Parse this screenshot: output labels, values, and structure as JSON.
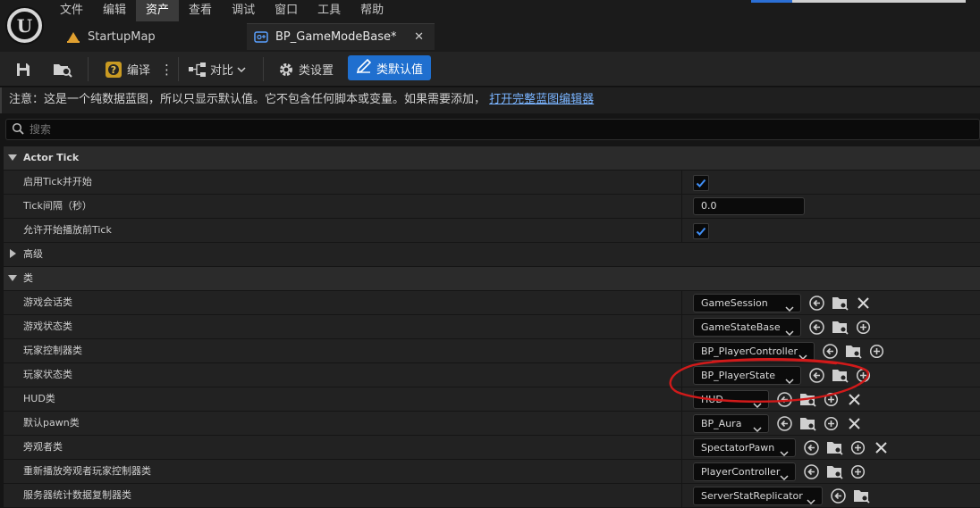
{
  "menu": [
    "文件",
    "编辑",
    "资产",
    "查看",
    "调试",
    "窗口",
    "工具",
    "帮助"
  ],
  "menu_active": "资产",
  "logo_text": "U",
  "tabs": {
    "map": "StartupMap",
    "blueprint": "BP_GameModeBase*",
    "close_glyph": "✕"
  },
  "toolbar": {
    "compile": "编译",
    "more": "⋮",
    "diff": "对比",
    "class_settings": "类设置",
    "class_defaults": "类默认值"
  },
  "note": {
    "text": "注意：这是一个纯数据蓝图，所以只显示默认值。它不包含任何脚本或变量。如果需要添加，",
    "link": "打开完整蓝图编辑器"
  },
  "search": {
    "placeholder": "搜索"
  },
  "categories": {
    "actor_tick": "Actor Tick",
    "advanced": "高级",
    "classes": "类"
  },
  "actor_tick": {
    "start_with_tick": {
      "label": "启用Tick并开始",
      "checked": true
    },
    "tick_interval": {
      "label": "Tick间隔（秒）",
      "value": "0.0"
    },
    "tick_before_begin_play": {
      "label": "允许开始播放前Tick",
      "checked": true
    }
  },
  "class_rows": [
    {
      "label": "游戏会话类",
      "value": "GameSession",
      "actions": [
        "use",
        "browse",
        "clear"
      ]
    },
    {
      "label": "游戏状态类",
      "value": "GameStateBase",
      "actions": [
        "use",
        "browse",
        "add"
      ]
    },
    {
      "label": "玩家控制器类",
      "value": "BP_PlayerController",
      "actions": [
        "use",
        "browse",
        "add"
      ]
    },
    {
      "label": "玩家状态类",
      "value": "BP_PlayerState",
      "actions": [
        "use",
        "browse",
        "add"
      ]
    },
    {
      "label": "HUD类",
      "value": "HUD",
      "actions": [
        "use",
        "browse",
        "add",
        "clear"
      ]
    },
    {
      "label": "默认pawn类",
      "value": "BP_Aura",
      "actions": [
        "use",
        "browse",
        "add",
        "clear"
      ]
    },
    {
      "label": "旁观者类",
      "value": "SpectatorPawn",
      "actions": [
        "use",
        "browse",
        "add",
        "clear"
      ]
    },
    {
      "label": "重新播放旁观者玩家控制器类",
      "value": "PlayerController",
      "actions": [
        "use",
        "browse",
        "add"
      ]
    },
    {
      "label": "服务器统计数据复制器类",
      "value": "ServerStatReplicator",
      "actions": [
        "use",
        "browse"
      ]
    }
  ],
  "colors": {
    "accent": "#1f6fcf",
    "check": "#3f8ef5",
    "annotation": "#d11a1a"
  },
  "icon_names": {
    "use": "arrow-left-circle-icon",
    "browse": "folder-search-icon",
    "add": "plus-circle-icon",
    "clear": "clear-x-icon"
  }
}
